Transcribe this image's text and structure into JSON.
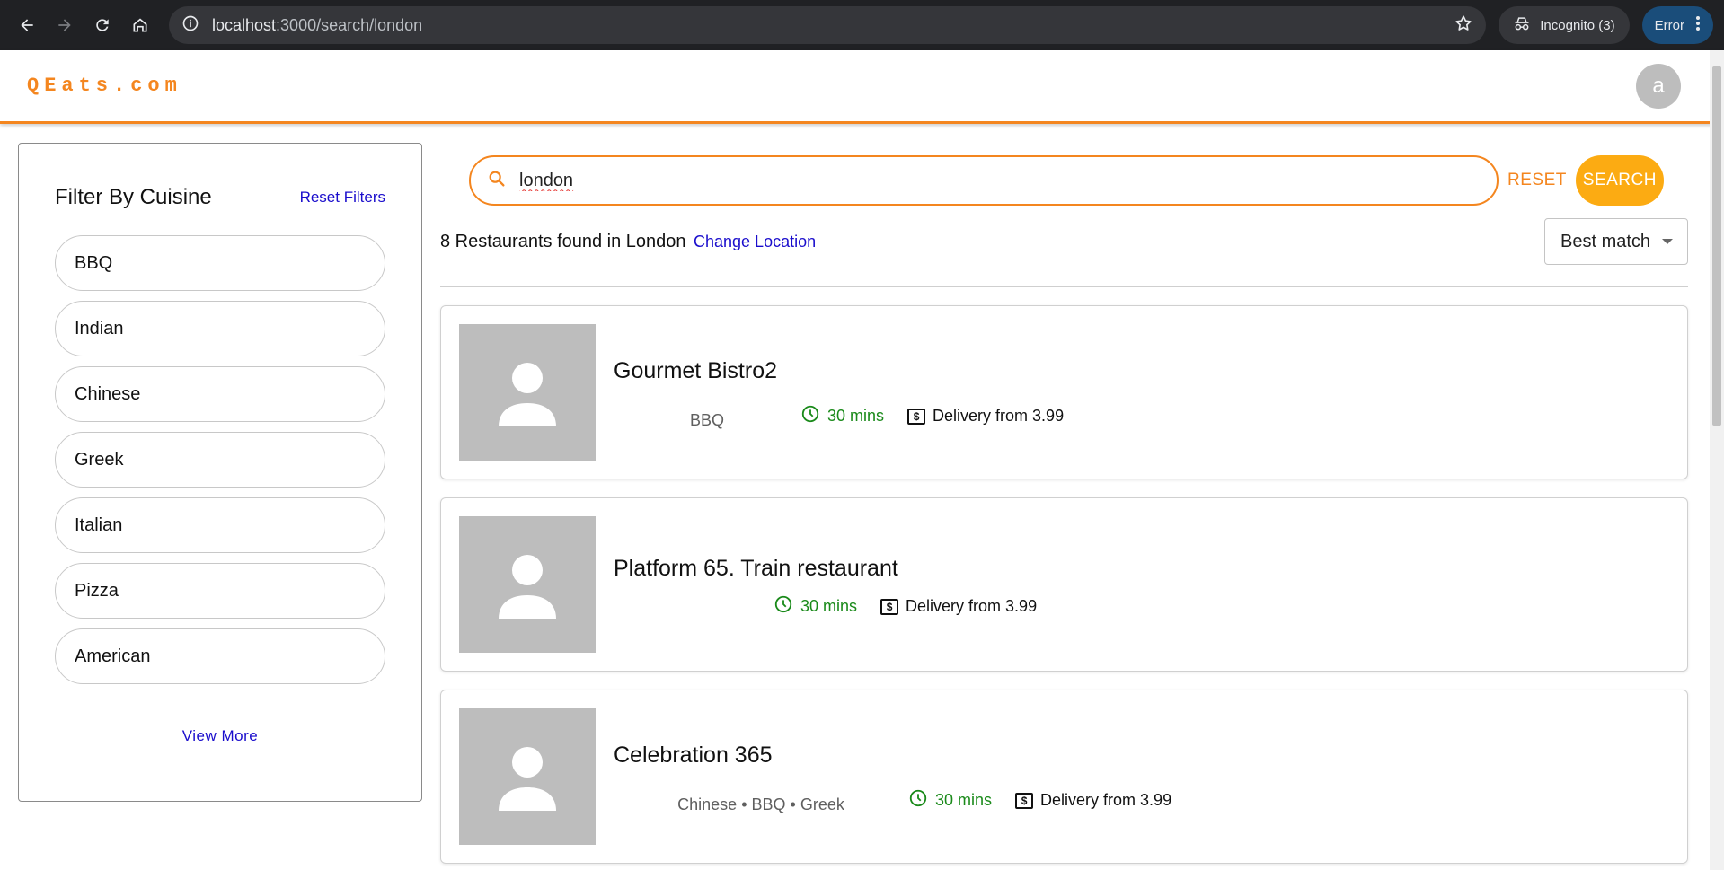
{
  "browser": {
    "url_host": "localhost",
    "url_path": ":3000/search/london",
    "incognito_label": "Incognito (3)",
    "error_label": "Error"
  },
  "header": {
    "logo": "QEats.com",
    "avatar_letter": "a"
  },
  "filters": {
    "title": "Filter By Cuisine",
    "reset_label": "Reset Filters",
    "cuisines": [
      "BBQ",
      "Indian",
      "Chinese",
      "Greek",
      "Italian",
      "Pizza",
      "American"
    ],
    "view_more_label": "View More"
  },
  "search": {
    "value": "london",
    "reset_label": "RESET",
    "search_label": "SEARCH"
  },
  "results": {
    "summary": "8 Restaurants found in London",
    "change_location_label": "Change Location",
    "sort_value": "Best match"
  },
  "restaurants": [
    {
      "name": "Gourmet Bistro2",
      "cuisines": "BBQ",
      "time": "30 mins",
      "delivery": "Delivery from 3.99"
    },
    {
      "name": "Platform 65. Train restaurant",
      "cuisines": "",
      "time": "30 mins",
      "delivery": "Delivery from 3.99"
    },
    {
      "name": "Celebration 365",
      "cuisines": "Chinese • BBQ • Greek",
      "time": "30 mins",
      "delivery": "Delivery from 3.99"
    }
  ],
  "colors": {
    "brand_orange": "#f4861f",
    "search_button": "#fcab12",
    "link_blue": "#1a0dcc",
    "time_green": "#1a8a1a"
  }
}
